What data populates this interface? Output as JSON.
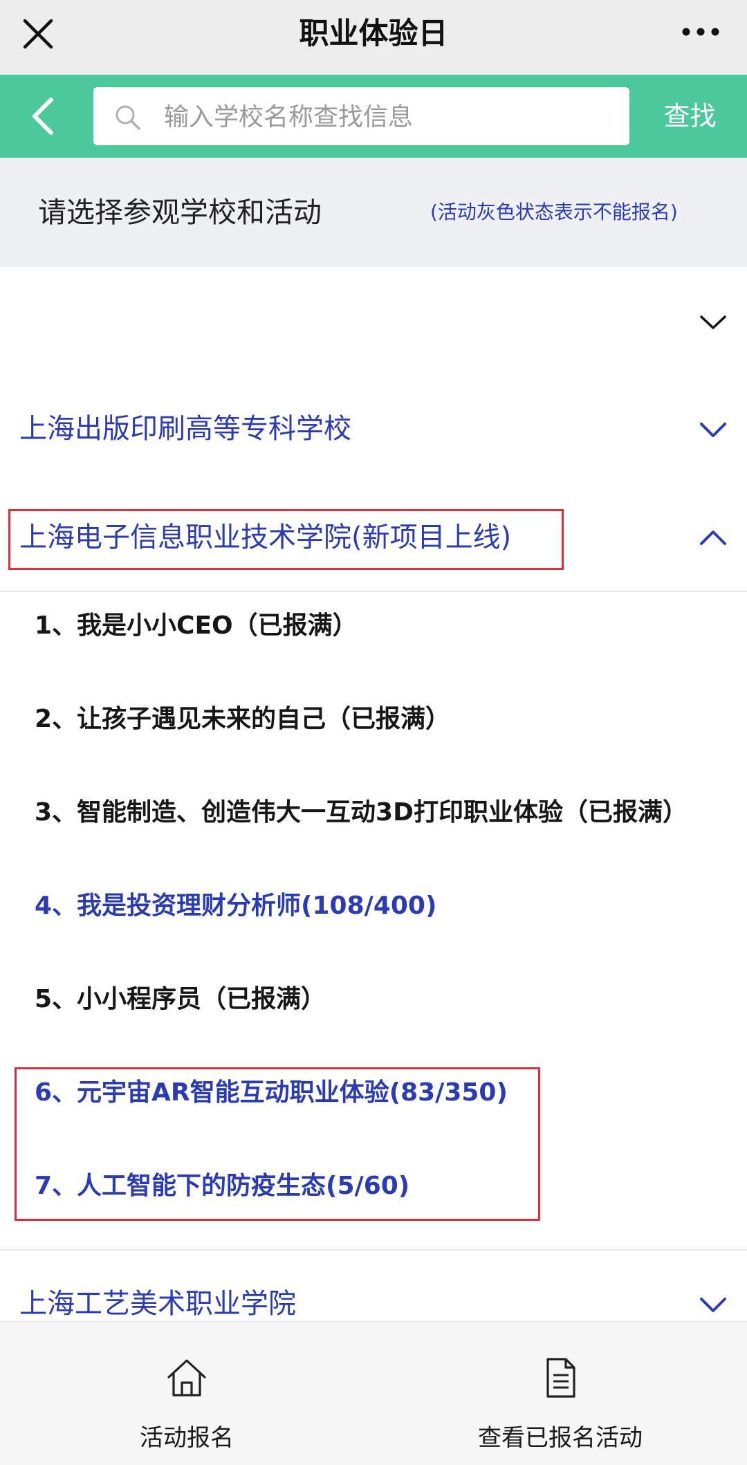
{
  "header": {
    "title": "职业体验日"
  },
  "search": {
    "placeholder": "输入学校名称查找信息",
    "button_label": "查找"
  },
  "instructions": {
    "title": "请选择参观学校和活动",
    "note": "(活动灰色状态表示不能报名)"
  },
  "schools": [
    {
      "name": "上海出版印刷高等专科学校",
      "expanded": false
    },
    {
      "name": "上海电子信息职业技术学院(新项目上线)",
      "expanded": true,
      "highlighted": true
    },
    {
      "name": "上海工艺美术职业学院",
      "expanded": false
    }
  ],
  "activities": [
    {
      "label": "1、我是小小CEO（已报满）",
      "available": false
    },
    {
      "label": "2、让孩子遇见未来的自己（已报满）",
      "available": false
    },
    {
      "label": "3、智能制造、创造伟大一互动3D打印职业体验（已报满）",
      "available": false
    },
    {
      "label": "4、我是投资理财分析师(108/400)",
      "available": true
    },
    {
      "label": "5、小小程序员（已报满）",
      "available": false
    },
    {
      "label": "6、元宇宙AR智能互动职业体验(83/350)",
      "available": true,
      "highlighted": true
    },
    {
      "label": "7、人工智能下的防疫生态(5/60)",
      "available": true,
      "highlighted": true
    }
  ],
  "tabs": [
    {
      "label": "活动报名",
      "icon": "home-icon"
    },
    {
      "label": "查看已报名活动",
      "icon": "document-icon"
    }
  ],
  "colors": {
    "accent_green": "#4cc99c",
    "link_blue": "#2b3bb3",
    "highlight_red": "#d8313c",
    "header_gray": "#ededed",
    "instruction_bg": "#eff0f4"
  }
}
